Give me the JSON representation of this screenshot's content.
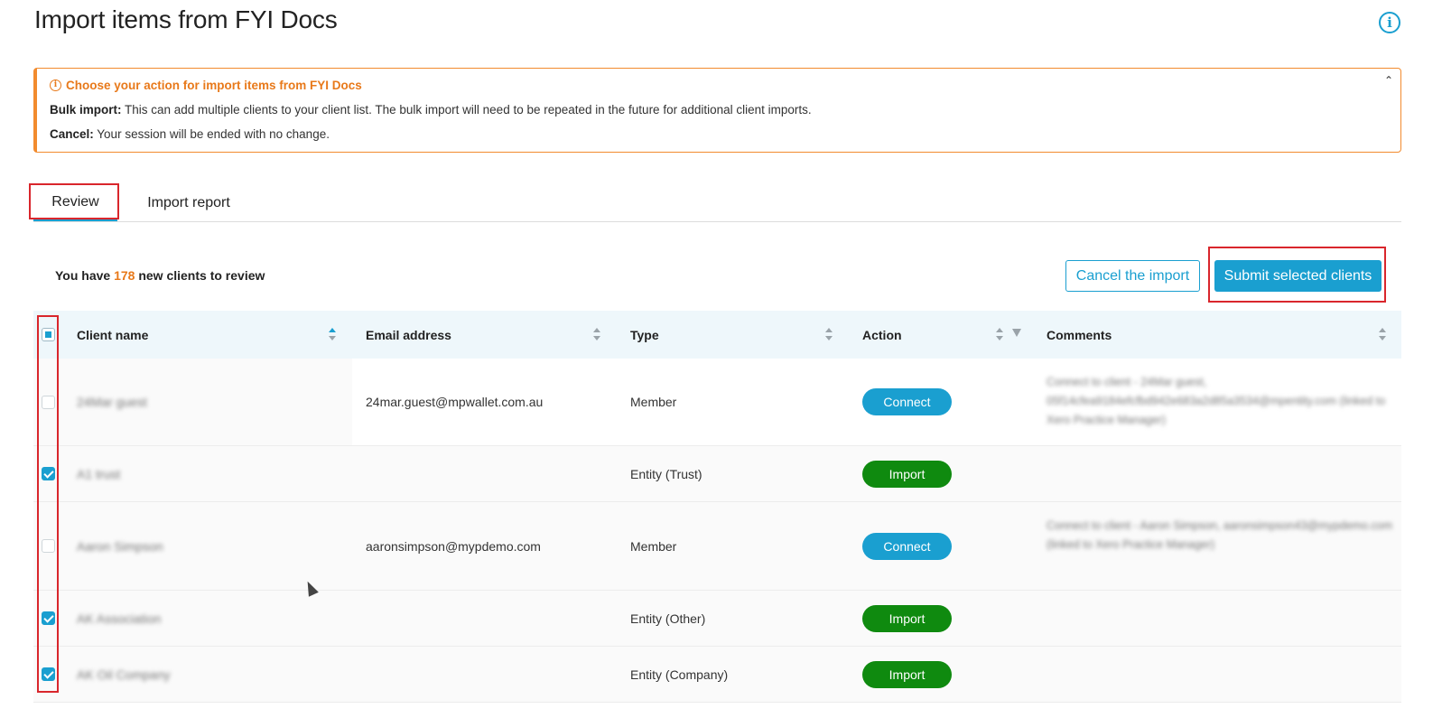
{
  "page": {
    "title": "Import items from FYI Docs",
    "help_icon": "info-circle-icon"
  },
  "notice": {
    "heading": "Choose your action for import items from FYI Docs",
    "bulk_label": "Bulk import:",
    "bulk_text": " This can add multiple clients to your client list. The bulk import will need to be repeated in the future for additional client imports.",
    "cancel_label": "Cancel:",
    "cancel_text": " Your session will be ended with no change.",
    "collapse_icon": "double-chevron-up-icon",
    "collapse_glyph": "⌃",
    "accent_color": "#f28b2e"
  },
  "tabs": [
    {
      "label": "Review",
      "active": true
    },
    {
      "label": "Import report",
      "active": false
    }
  ],
  "review": {
    "prefix": "You have ",
    "count": "178",
    "suffix": " new clients to review"
  },
  "actions": {
    "cancel_label": "Cancel the import",
    "submit_label": "Submit selected clients"
  },
  "table": {
    "columns": [
      {
        "label": "Client name",
        "sort": "asc"
      },
      {
        "label": "Email address",
        "sort": "none"
      },
      {
        "label": "Type",
        "sort": "none"
      },
      {
        "label": "Action",
        "sort": "none",
        "filter": true
      },
      {
        "label": "Comments",
        "sort": "none"
      }
    ],
    "rows": [
      {
        "checked": false,
        "client_name": "24Mar guest",
        "email": "24mar.guest@mpwallet.com.au",
        "type": "Member",
        "action": "Connect",
        "comment": "Connect to client - 24Mar guest, 05f14cfea9184efcfbd942e683a2d85a3534@mpentity.com (linked to Xero Practice Manager)"
      },
      {
        "checked": true,
        "client_name": "A1 trust",
        "email": "",
        "type": "Entity (Trust)",
        "action": "Import",
        "comment": ""
      },
      {
        "checked": false,
        "client_name": "Aaron Simpson",
        "email": "aaronsimpson@mypdemo.com",
        "type": "Member",
        "action": "Connect",
        "comment": "Connect to client - Aaron Simpson, aaronsimpson43@mypdemo.com (linked to Xero Practice Manager)"
      },
      {
        "checked": true,
        "client_name": "AK Association",
        "email": "",
        "type": "Entity (Other)",
        "action": "Import",
        "comment": ""
      },
      {
        "checked": true,
        "client_name": "AK Oil Company",
        "email": "",
        "type": "Entity (Company)",
        "action": "Import",
        "comment": ""
      }
    ]
  },
  "colors": {
    "primary": "#1a9fd0",
    "import_green": "#0f8a0f",
    "highlight_red": "#d9262c"
  }
}
